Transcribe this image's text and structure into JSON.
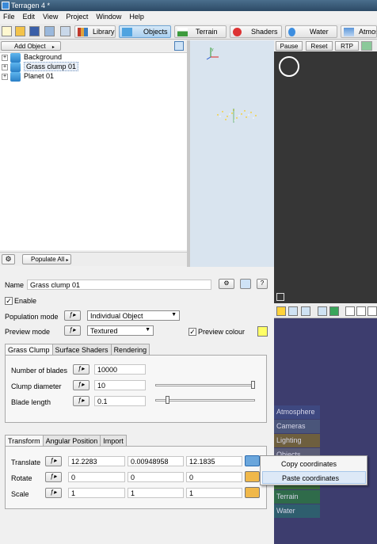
{
  "window": {
    "title": "Terragen 4 *"
  },
  "menu": [
    "File",
    "Edit",
    "View",
    "Project",
    "Window",
    "Help"
  ],
  "toolbar": {
    "library": "Library",
    "objects": "Objects",
    "terrain": "Terrain",
    "shaders": "Shaders",
    "water": "Water",
    "atmosphere": "Atmosp"
  },
  "left_panel": {
    "add_object": "Add Object",
    "tree": [
      "Background",
      "Grass clump 01",
      "Planet 01"
    ],
    "populate_all": "Populate All"
  },
  "render_bar": {
    "pause": "Pause",
    "reset": "Reset",
    "rtp": "RTP"
  },
  "node_labels": [
    "Atmosphere",
    "Cameras",
    "Lighting",
    "Objects",
    "Terrain",
    "Water"
  ],
  "properties": {
    "name_label": "Name",
    "name_value": "Grass clump 01",
    "enable_label": "Enable",
    "enable_checked": "✓",
    "population_mode_label": "Population mode",
    "population_mode_value": "Individual Object",
    "preview_mode_label": "Preview mode",
    "preview_mode_value": "Textured",
    "preview_colour_label": "Preview colour",
    "preview_colour_checked": "✓",
    "preview_colour": "#ffff66",
    "tabs": [
      "Grass Clump",
      "Surface Shaders",
      "Rendering"
    ],
    "blades_label": "Number of blades",
    "blades_value": "10000",
    "clump_diameter_label": "Clump diameter",
    "clump_diameter_value": "10",
    "blade_length_label": "Blade length",
    "blade_length_value": "0.1",
    "transform_tabs": [
      "Transform",
      "Angular Position",
      "Import"
    ],
    "translate_label": "Translate",
    "translate": [
      "12.2283",
      "0.00948958",
      "12.1835"
    ],
    "rotate_label": "Rotate",
    "rotate": [
      "0",
      "0",
      "0"
    ],
    "scale_label": "Scale",
    "scale": [
      "1",
      "1",
      "1"
    ]
  },
  "context_menu": {
    "copy": "Copy coordinates",
    "paste": "Paste coordinates"
  },
  "colors": {
    "render_bg": "#363636",
    "node_bg": "#3d3d6e",
    "viewport_bg": "#d9e4ef"
  }
}
